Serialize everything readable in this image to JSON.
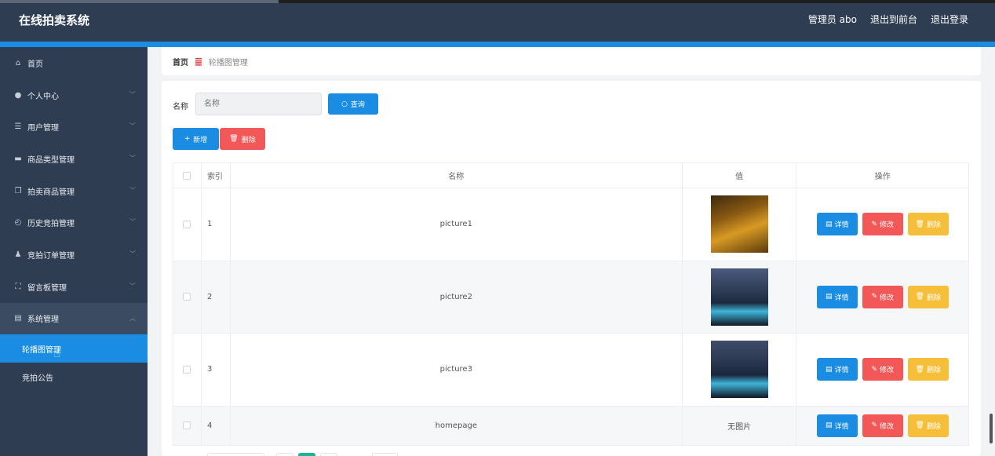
{
  "app": {
    "title": "在线拍卖系统",
    "user_label": "管理员 abo",
    "to_front_label": "退出到前台",
    "logout_label": "退出登录"
  },
  "sidebar": {
    "items": [
      {
        "label": "首页",
        "icon": "home-icon"
      },
      {
        "label": "个人中心",
        "icon": "user-icon"
      },
      {
        "label": "用户管理",
        "icon": "sliders-icon"
      },
      {
        "label": "商品类型管理",
        "icon": "monitor-icon"
      },
      {
        "label": "拍卖商品管理",
        "icon": "copy-icon"
      },
      {
        "label": "历史竞拍管理",
        "icon": "compass-icon"
      },
      {
        "label": "竞拍订单管理",
        "icon": "person-icon"
      },
      {
        "label": "留言板管理",
        "icon": "frame-icon"
      },
      {
        "label": "系统管理",
        "icon": "clipboard-icon"
      }
    ],
    "sub_items": [
      {
        "label": "轮播图管理"
      },
      {
        "label": "竞拍公告"
      }
    ]
  },
  "breadcrumb": {
    "home": "首页",
    "separator": "䷀",
    "current": "轮播图管理"
  },
  "search": {
    "label": "名称",
    "placeholder": "名称",
    "query_label": "查询"
  },
  "actions": {
    "add_label": "新增",
    "delete_label": "删除"
  },
  "table": {
    "columns": [
      "索引",
      "名称",
      "值",
      "操作"
    ],
    "rows": [
      {
        "index": "1",
        "name": "picture1",
        "value": ""
      },
      {
        "index": "2",
        "name": "picture2",
        "value": ""
      },
      {
        "index": "3",
        "name": "picture3",
        "value": ""
      },
      {
        "index": "4",
        "name": "homepage",
        "value": "无图片"
      }
    ],
    "op_labels": {
      "detail": "详情",
      "edit": "修改",
      "delete": "删除"
    }
  },
  "colors": {
    "primary": "#1a8de2",
    "danger": "#f35858",
    "warning": "#f5bf3a",
    "header_bg": "#2e3d52",
    "sidebar_bg": "#2f3d52"
  }
}
